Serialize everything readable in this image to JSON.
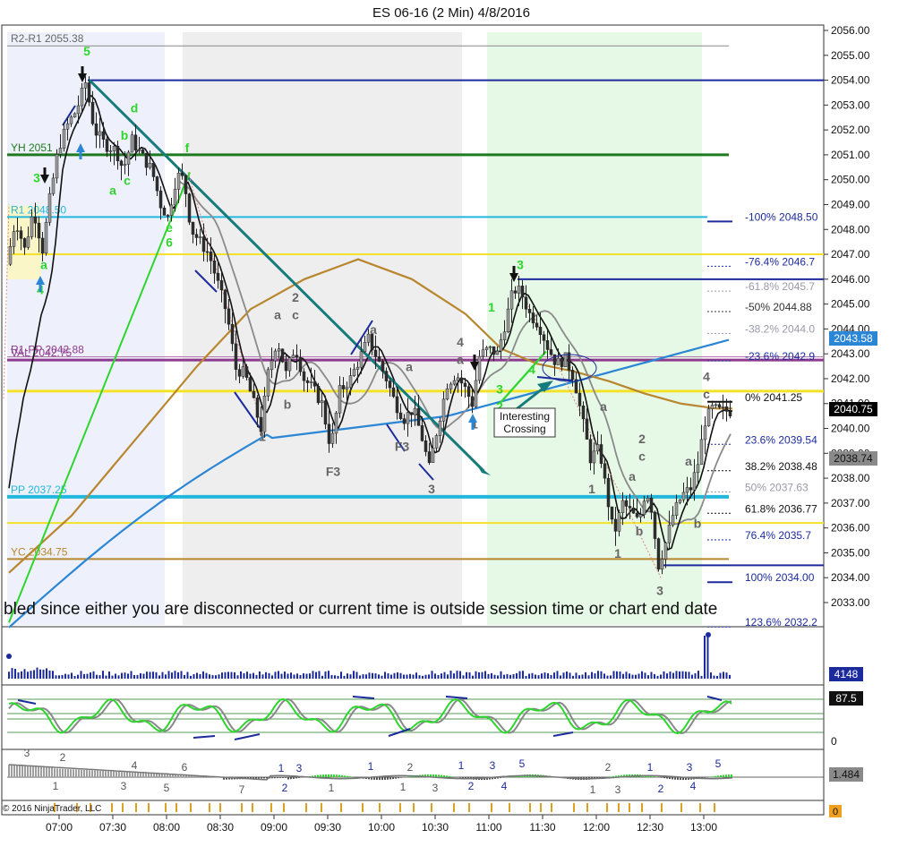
{
  "window": {
    "title": "ES 06-16 (2 Min)  4/8/2016"
  },
  "colors": {
    "up": "#9e9e9e",
    "down": "#2e2e2e",
    "navy": "#1c2b9c",
    "yellow": "#f3e12a",
    "green_line": "#1f7a1f",
    "cyan": "#22b8de",
    "purple": "#8e3a8e",
    "orange": "#b8862e",
    "blue_ma": "#2b86d6",
    "gray_ma": "#8a8a8a",
    "bright_green": "#2dd62d",
    "teal": "#167b7b"
  },
  "copyright": "© 2016 NinjaTrader, LLC",
  "warning": "bled since either you are disconnected or current time is outside session time or chart end date",
  "annotation": {
    "text_1": "Interesting",
    "text_2": "Crossing"
  },
  "price_badges": {
    "last": "2040.75",
    "blue_ma": "2043.58",
    "gray_ma": "2038.74"
  },
  "volume_badge": "4148",
  "stoch_badge": "87.5",
  "stoch_zero": "0",
  "macd_badge": "1.484",
  "bottom_badge": "0",
  "chart_data": {
    "type": "candlestick",
    "title": "ES 06-16 (2 Min)  4/8/2016",
    "x_ticks": [
      "07:00",
      "07:30",
      "08:00",
      "08:30",
      "09:00",
      "09:30",
      "10:00",
      "10:30",
      "11:00",
      "11:30",
      "12:00",
      "12:30",
      "13:00"
    ],
    "y_ticks": [
      "2056.00",
      "2055.00",
      "2054.00",
      "2053.00",
      "2052.00",
      "2051.00",
      "2050.00",
      "2049.00",
      "2048.00",
      "2047.00",
      "2046.00",
      "2045.00",
      "2044.00",
      "2043.00",
      "2042.00",
      "2041.00",
      "2040.00",
      "2039.00",
      "2038.00",
      "2037.00",
      "2036.00",
      "2035.00",
      "2034.00",
      "2033.00"
    ],
    "ylim": [
      2032.0,
      2056.2
    ],
    "levels": [
      {
        "label": "R2-R1 2055.38",
        "price": 2055.38
      },
      {
        "label": "",
        "price": 2054.0
      },
      {
        "label": "YH 2051",
        "price": 2051.0
      },
      {
        "label": "R1 2048.50",
        "price": 2048.5
      },
      {
        "label": "",
        "price": 2047.0
      },
      {
        "label": "",
        "price": 2046.0
      },
      {
        "label": "R1-PP 2042.88",
        "price": 2042.88
      },
      {
        "label": "VAL 2042.75",
        "price": 2042.75
      },
      {
        "label": "",
        "price": 2041.5
      },
      {
        "label": "PP 2037.25",
        "price": 2037.25
      },
      {
        "label": "",
        "price": 2036.2
      },
      {
        "label": "YC 2034.75",
        "price": 2034.75
      },
      {
        "label": "",
        "price": 2034.5
      }
    ],
    "fib_levels": [
      {
        "label": "-100%  2048.50",
        "price": 2048.5
      },
      {
        "label": "-76.4%  2046.7",
        "price": 2046.7
      },
      {
        "label": "-61.8%  2045.7",
        "price": 2045.7
      },
      {
        "label": "-50%  2044.88",
        "price": 2044.88
      },
      {
        "label": "-38.2%  2044.0",
        "price": 2044.0
      },
      {
        "label": "-23.6%  2042.9",
        "price": 2042.9
      },
      {
        "label": "0%  2041.25",
        "price": 2041.25
      },
      {
        "label": "23.6%  2039.54",
        "price": 2039.54
      },
      {
        "label": "38.2%  2038.48",
        "price": 2038.48
      },
      {
        "label": "50%  2037.63",
        "price": 2037.63
      },
      {
        "label": "61.8%  2036.77",
        "price": 2036.77
      },
      {
        "label": "76.4%  2035.7",
        "price": 2035.7
      },
      {
        "label": "100%  2034.00",
        "price": 2034.0
      },
      {
        "label": "123.6%  2032.2",
        "price": 2032.2
      }
    ],
    "wave_labels": [
      {
        "t": "5",
        "x": 97,
        "p": 2055.0,
        "c": "#2dd62d"
      },
      {
        "t": "3",
        "x": 41,
        "p": 2049.9,
        "c": "#2dd62d"
      },
      {
        "t": "4",
        "x": 45,
        "p": 2045.4,
        "c": "#2dd62d"
      },
      {
        "t": "a",
        "x": 49,
        "p": 2046.4,
        "c": "#2dd62d"
      },
      {
        "t": "a",
        "x": 126,
        "p": 2049.4,
        "c": "#2dd62d"
      },
      {
        "t": "b",
        "x": 139,
        "p": 2051.6,
        "c": "#2dd62d"
      },
      {
        "t": "c",
        "x": 142,
        "p": 2049.8,
        "c": "#2dd62d"
      },
      {
        "t": "d",
        "x": 150,
        "p": 2052.7,
        "c": "#2dd62d"
      },
      {
        "t": "f",
        "x": 209,
        "p": 2051.1,
        "c": "#2dd62d"
      },
      {
        "t": "e",
        "x": 189,
        "p": 2047.9,
        "c": "#2dd62d"
      },
      {
        "t": "6",
        "x": 189,
        "p": 2047.3,
        "c": "#2dd62d"
      },
      {
        "t": "a",
        "x": 310,
        "p": 2044.4,
        "c": "#666666"
      },
      {
        "t": "2",
        "x": 330,
        "p": 2045.1,
        "c": "#666666"
      },
      {
        "t": "c",
        "x": 330,
        "p": 2044.4,
        "c": "#666666"
      },
      {
        "t": "b",
        "x": 321,
        "p": 2040.8,
        "c": "#666666"
      },
      {
        "t": "1",
        "x": 293,
        "p": 2039.5,
        "c": "#666666"
      },
      {
        "t": "F3",
        "x": 372,
        "p": 2038.1,
        "c": "#666666"
      },
      {
        "t": "a",
        "x": 417,
        "p": 2043.8,
        "c": "#666666"
      },
      {
        "t": "a",
        "x": 457,
        "p": 2042.3,
        "c": "#666666"
      },
      {
        "t": "F3",
        "x": 449,
        "p": 2039.1,
        "c": "#666666"
      },
      {
        "t": "3",
        "x": 482,
        "p": 2037.4,
        "c": "#666666"
      },
      {
        "t": "4",
        "x": 514,
        "p": 2043.3,
        "c": "#666666"
      },
      {
        "t": "a",
        "x": 514,
        "p": 2042.6,
        "c": "#666666"
      },
      {
        "t": "1",
        "x": 530,
        "p": 2040.0,
        "c": "#666666"
      },
      {
        "t": "1",
        "x": 549,
        "p": 2044.7,
        "c": "#2dd62d"
      },
      {
        "t": "3",
        "x": 581,
        "p": 2046.4,
        "c": "#2dd62d"
      },
      {
        "t": "4",
        "x": 594,
        "p": 2042.2,
        "c": "#2dd62d"
      },
      {
        "t": "3",
        "x": 558,
        "p": 2041.4,
        "c": "#2dd62d"
      },
      {
        "t": "2",
        "x": 558,
        "p": 2040.7,
        "c": "#2dd62d"
      },
      {
        "t": "a",
        "x": 674,
        "p": 2040.7,
        "c": "#666666"
      },
      {
        "t": "1",
        "x": 661,
        "p": 2037.4,
        "c": "#666666"
      },
      {
        "t": "2",
        "x": 717,
        "p": 2039.4,
        "c": "#666666"
      },
      {
        "t": "c",
        "x": 717,
        "p": 2038.7,
        "c": "#666666"
      },
      {
        "t": "a",
        "x": 706,
        "p": 2037.9,
        "c": "#666666"
      },
      {
        "t": "b",
        "x": 714,
        "p": 2035.7,
        "c": "#666666"
      },
      {
        "t": "1",
        "x": 690,
        "p": 2034.8,
        "c": "#666666"
      },
      {
        "t": "3",
        "x": 737,
        "p": 2033.3,
        "c": "#666666"
      },
      {
        "t": "a",
        "x": 769,
        "p": 2038.5,
        "c": "#666666"
      },
      {
        "t": "b",
        "x": 779,
        "p": 2036.0,
        "c": "#666666"
      },
      {
        "t": "4",
        "x": 789,
        "p": 2041.9,
        "c": "#666666"
      },
      {
        "t": "c",
        "x": 789,
        "p": 2041.2,
        "c": "#666666"
      }
    ],
    "macd_labels": [
      {
        "t": "3",
        "x": 30,
        "y": 845,
        "c": "#555555"
      },
      {
        "t": "2",
        "x": 70,
        "y": 850,
        "c": "#555555"
      },
      {
        "t": "1",
        "x": 62,
        "y": 882,
        "c": "#555555"
      },
      {
        "t": "4",
        "x": 150,
        "y": 859,
        "c": "#555555"
      },
      {
        "t": "3",
        "x": 138,
        "y": 882,
        "c": "#555555"
      },
      {
        "t": "6",
        "x": 206,
        "y": 861,
        "c": "#555555"
      },
      {
        "t": "5",
        "x": 186,
        "y": 884,
        "c": "#555555"
      },
      {
        "t": "7",
        "x": 270,
        "y": 886,
        "c": "#555555"
      },
      {
        "t": "1",
        "x": 314,
        "y": 862,
        "c": "#1c2b9c"
      },
      {
        "t": "3",
        "x": 334,
        "y": 862,
        "c": "#1c2b9c"
      },
      {
        "t": "2",
        "x": 318,
        "y": 884,
        "c": "#1c2b9c"
      },
      {
        "t": "1",
        "x": 370,
        "y": 884,
        "c": "#555555"
      },
      {
        "t": "1",
        "x": 414,
        "y": 860,
        "c": "#1c2b9c"
      },
      {
        "t": "2",
        "x": 458,
        "y": 861,
        "c": "#555555"
      },
      {
        "t": "1",
        "x": 450,
        "y": 883,
        "c": "#555555"
      },
      {
        "t": "3",
        "x": 486,
        "y": 884,
        "c": "#555555"
      },
      {
        "t": "1",
        "x": 515,
        "y": 859,
        "c": "#1c2b9c"
      },
      {
        "t": "3",
        "x": 550,
        "y": 859,
        "c": "#1c2b9c"
      },
      {
        "t": "5",
        "x": 583,
        "y": 857,
        "c": "#1c2b9c"
      },
      {
        "t": "2",
        "x": 526,
        "y": 882,
        "c": "#1c2b9c"
      },
      {
        "t": "4",
        "x": 563,
        "y": 882,
        "c": "#1c2b9c"
      },
      {
        "t": "2",
        "x": 679,
        "y": 861,
        "c": "#555555"
      },
      {
        "t": "1",
        "x": 662,
        "y": 886,
        "c": "#555555"
      },
      {
        "t": "3",
        "x": 690,
        "y": 886,
        "c": "#555555"
      },
      {
        "t": "1",
        "x": 726,
        "y": 861,
        "c": "#1c2b9c"
      },
      {
        "t": "3",
        "x": 770,
        "y": 861,
        "c": "#1c2b9c"
      },
      {
        "t": "5",
        "x": 802,
        "y": 857,
        "c": "#1c2b9c"
      },
      {
        "t": "2",
        "x": 738,
        "y": 885,
        "c": "#1c2b9c"
      },
      {
        "t": "4",
        "x": 774,
        "y": 882,
        "c": "#1c2b9c"
      }
    ]
  }
}
